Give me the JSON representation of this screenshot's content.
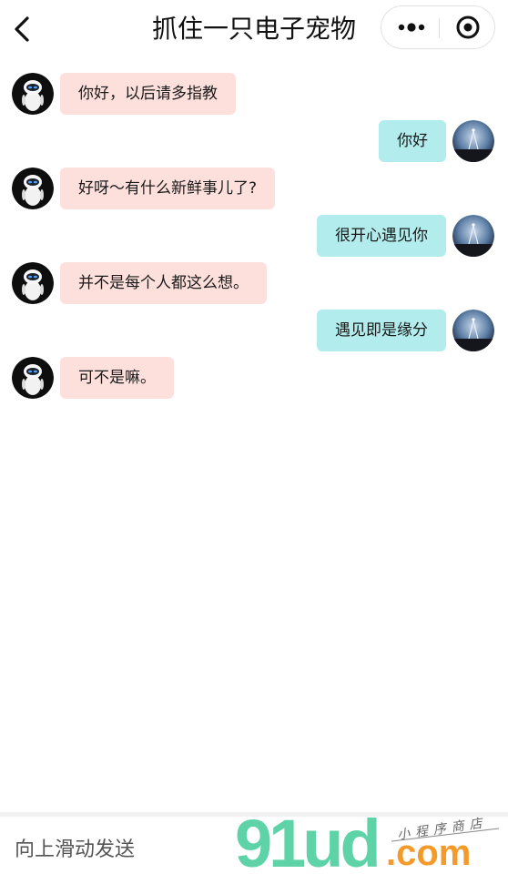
{
  "nav": {
    "title": "抓住一只电子宠物",
    "back_icon": "chevron-left-icon",
    "more_icon": "more-dots-icon",
    "close_icon": "target-close-icon"
  },
  "messages": [
    {
      "side": "left",
      "text": "你好，以后请多指教"
    },
    {
      "side": "right",
      "text": "你好"
    },
    {
      "side": "left",
      "text": "好呀～有什么新鲜事儿了?"
    },
    {
      "side": "right",
      "text": "很开心遇见你"
    },
    {
      "side": "left",
      "text": "并不是每个人都这么想。"
    },
    {
      "side": "right",
      "text": "遇见即是缘分"
    },
    {
      "side": "left",
      "text": "可不是嘛。"
    }
  ],
  "input": {
    "placeholder": "向上滑动发送"
  },
  "watermark": {
    "brand": "91ud",
    "suffix": ".com",
    "tagline": "小程序商店"
  },
  "colors": {
    "left_bubble": "#fde0dc",
    "right_bubble": "#b2ecec",
    "watermark_green": "#5fd3a8",
    "watermark_orange": "#f39a2b"
  }
}
